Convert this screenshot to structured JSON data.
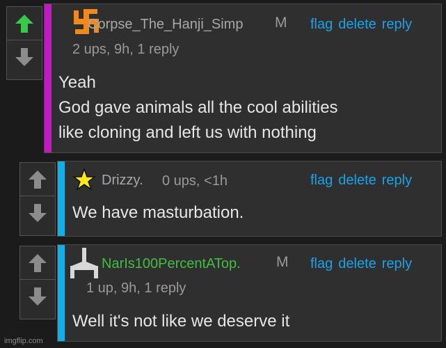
{
  "colors": {
    "accent_link": "#1aa3e8",
    "stripe_op": "#c518c5",
    "stripe_reply": "#11b0e8",
    "username_gray": "#a8a8a8",
    "username_green": "#3fbf3f",
    "upvote_active": "#38c84a",
    "vote_inactive": "#8c8c8c"
  },
  "comments": [
    {
      "username": "Corpse_The_Hanji_Simp",
      "badge": "M",
      "meta": "2 ups, 9h, 1 reply",
      "actions": [
        "flag",
        "delete",
        "reply"
      ],
      "body": [
        "Yeah",
        "God gave animals all the cool abilities",
        "like cloning and left us with nothing"
      ],
      "icon": "orange-swastika-icon",
      "upvoted": true
    },
    {
      "username": "Drizzy.",
      "meta": "0 ups, <1h",
      "actions": [
        "flag",
        "delete",
        "reply"
      ],
      "body": [
        "We have masturbation."
      ],
      "icon": "star-icon",
      "upvoted": false
    },
    {
      "username": "NarIs100PercentATop.",
      "badge": "M",
      "meta": "1 up, 9h, 1 reply",
      "actions": [
        "flag",
        "delete",
        "reply"
      ],
      "body": [
        "Well it's not like we deserve it"
      ],
      "icon": "white-cross-icon",
      "upvoted": false
    }
  ],
  "watermark": "imgflip.com"
}
